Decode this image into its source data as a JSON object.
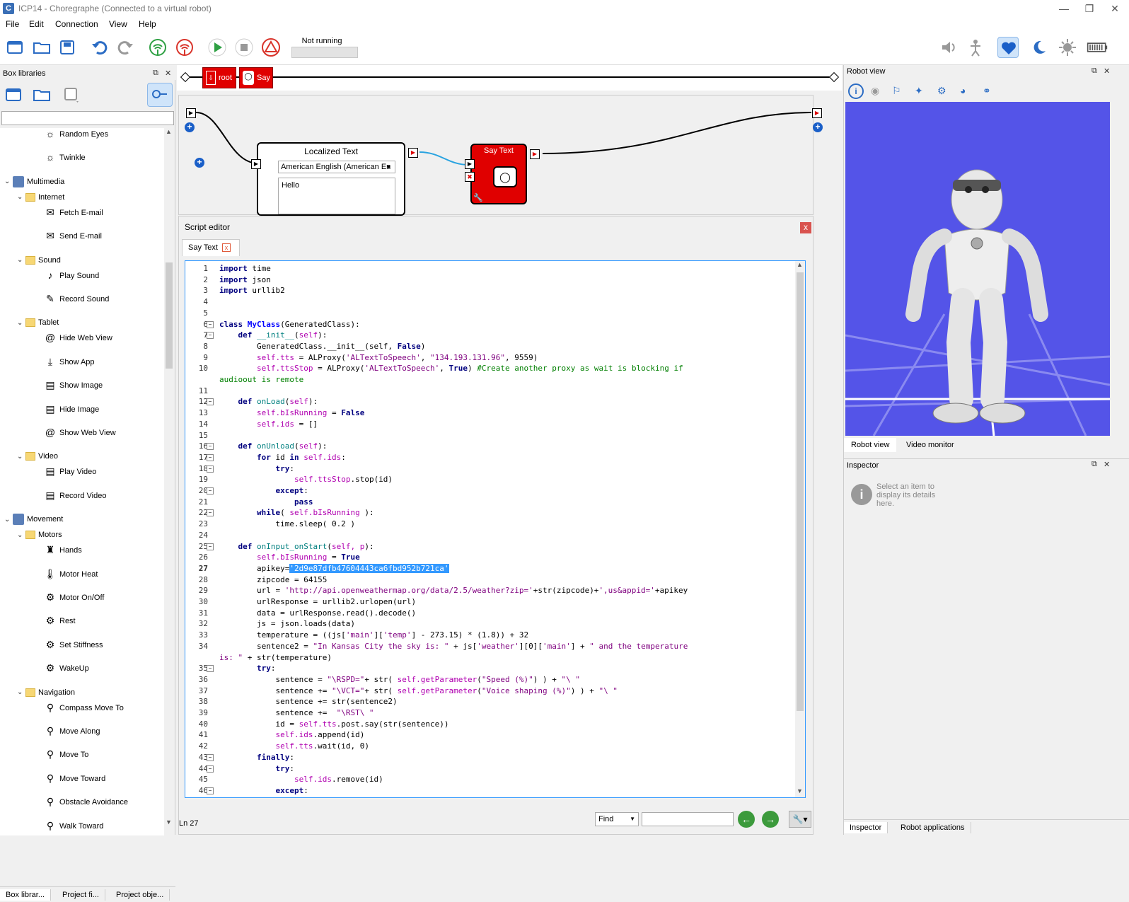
{
  "window": {
    "title": "ICP14 - Choregraphe (Connected to a virtual robot)",
    "app_icon_letter": "C"
  },
  "menu": [
    "File",
    "Edit",
    "Connection",
    "View",
    "Help"
  ],
  "toolbar": {
    "status_label": "Not running"
  },
  "box_libraries": {
    "title": "Box libraries",
    "tree": [
      {
        "label": "Random Eyes",
        "level": 2,
        "type": "box",
        "icon": "random-eyes-icon"
      },
      {
        "label": "Twinkle",
        "level": 2,
        "type": "box",
        "icon": "twinkle-icon"
      },
      {
        "label": "Multimedia",
        "level": 0,
        "type": "category",
        "icon": "multimedia-icon"
      },
      {
        "label": "Internet",
        "level": 1,
        "type": "folder",
        "icon": "folder-icon"
      },
      {
        "label": "Fetch E-mail",
        "level": 2,
        "type": "box",
        "icon": "email-icon"
      },
      {
        "label": "Send E-mail",
        "level": 2,
        "type": "box",
        "icon": "email-icon"
      },
      {
        "label": "Sound",
        "level": 1,
        "type": "folder",
        "icon": "folder-icon"
      },
      {
        "label": "Play Sound",
        "level": 2,
        "type": "box",
        "icon": "music-note-icon"
      },
      {
        "label": "Record Sound",
        "level": 2,
        "type": "box",
        "icon": "pen-icon"
      },
      {
        "label": "Tablet",
        "level": 1,
        "type": "folder",
        "icon": "folder-icon"
      },
      {
        "label": "Hide Web View",
        "level": 2,
        "type": "box",
        "icon": "at-icon"
      },
      {
        "label": "Show App",
        "level": 2,
        "type": "box",
        "icon": "download-icon"
      },
      {
        "label": "Show Image",
        "level": 2,
        "type": "box",
        "icon": "film-icon"
      },
      {
        "label": "Hide Image",
        "level": 2,
        "type": "box",
        "icon": "film-icon"
      },
      {
        "label": "Show Web View",
        "level": 2,
        "type": "box",
        "icon": "at-icon"
      },
      {
        "label": "Video",
        "level": 1,
        "type": "folder",
        "icon": "folder-icon"
      },
      {
        "label": "Play Video",
        "level": 2,
        "type": "box",
        "icon": "film-icon"
      },
      {
        "label": "Record Video",
        "level": 2,
        "type": "box",
        "icon": "film-icon"
      },
      {
        "label": "Movement",
        "level": 0,
        "type": "category",
        "icon": "movement-icon"
      },
      {
        "label": "Motors",
        "level": 1,
        "type": "folder",
        "icon": "folder-icon"
      },
      {
        "label": "Hands",
        "level": 2,
        "type": "box",
        "icon": "robot-icon"
      },
      {
        "label": "Motor Heat",
        "level": 2,
        "type": "box",
        "icon": "thermometer-icon"
      },
      {
        "label": "Motor On/Off",
        "level": 2,
        "type": "box",
        "icon": "gear-icon"
      },
      {
        "label": "Rest",
        "level": 2,
        "type": "box",
        "icon": "gear-icon"
      },
      {
        "label": "Set Stiffness",
        "level": 2,
        "type": "box",
        "icon": "gear-icon"
      },
      {
        "label": "WakeUp",
        "level": 2,
        "type": "box",
        "icon": "gear-icon"
      },
      {
        "label": "Navigation",
        "level": 1,
        "type": "folder",
        "icon": "folder-icon"
      },
      {
        "label": "Compass Move To",
        "level": 2,
        "type": "box",
        "icon": "walk-icon"
      },
      {
        "label": "Move Along",
        "level": 2,
        "type": "box",
        "icon": "walk-icon"
      },
      {
        "label": "Move To",
        "level": 2,
        "type": "box",
        "icon": "walk-icon"
      },
      {
        "label": "Move Toward",
        "level": 2,
        "type": "box",
        "icon": "walk-icon"
      },
      {
        "label": "Obstacle Avoidance",
        "level": 2,
        "type": "box",
        "icon": "walk-icon"
      },
      {
        "label": "Walk Toward",
        "level": 2,
        "type": "box",
        "icon": "walk-icon"
      }
    ],
    "bottom_tabs": [
      "Box librar...",
      "Project fi...",
      "Project obje..."
    ]
  },
  "timeline": {
    "boxes": [
      "root",
      "Say"
    ]
  },
  "flow": {
    "localized_text": {
      "title": "Localized Text",
      "language": "American English (American En",
      "text": "Hello"
    },
    "say_text": {
      "title": "Say Text"
    }
  },
  "script_editor": {
    "title": "Script editor",
    "tab": "Say Text",
    "close_symbol": "x",
    "line_indicator": "Ln 27",
    "find_label": "Find",
    "lines": [
      {
        "n": "1",
        "html": "<span class='kw'>import</span> time",
        "fold": false
      },
      {
        "n": "2",
        "html": "<span class='kw'>import</span> json",
        "fold": false
      },
      {
        "n": "3",
        "html": "<span class='kw'>import</span> urllib2",
        "fold": false
      },
      {
        "n": "4",
        "html": "",
        "fold": false
      },
      {
        "n": "5",
        "html": "",
        "fold": false
      },
      {
        "n": "6",
        "html": "<span class='kw'>class</span> <span class='cls'>MyClass</span>(GeneratedClass):",
        "fold": true
      },
      {
        "n": "7",
        "html": "    <span class='kw'>def</span> <span class='fn'>__init__</span>(<span class='self'>self</span>):",
        "fold": true
      },
      {
        "n": "8",
        "html": "        GeneratedClass.__init__(self, <span class='kw'>False</span>)",
        "fold": false
      },
      {
        "n": "9",
        "html": "        <span class='self'>self.tts</span> = ALProxy(<span class='st'>'ALTextToSpeech'</span>, <span class='st'>\"134.193.131.96\"</span>, 9559)",
        "fold": false
      },
      {
        "n": "10",
        "html": "        <span class='self'>self.ttsStop</span> = ALProxy(<span class='st'>'ALTextToSpeech'</span>, <span class='kw'>True</span>) <span class='cm'>#Create another proxy as wait is blocking if</span>",
        "fold": false
      },
      {
        "n": "",
        "html": "<span class='cm'>audioout is remote</span>",
        "fold": false
      },
      {
        "n": "11",
        "html": "",
        "fold": false
      },
      {
        "n": "12",
        "html": "    <span class='kw'>def</span> <span class='fn'>onLoad</span>(<span class='self'>self</span>):",
        "fold": true
      },
      {
        "n": "13",
        "html": "        <span class='self'>self.bIsRunning</span> = <span class='kw'>False</span>",
        "fold": false
      },
      {
        "n": "14",
        "html": "        <span class='self'>self.ids</span> = []",
        "fold": false
      },
      {
        "n": "15",
        "html": "",
        "fold": false
      },
      {
        "n": "16",
        "html": "    <span class='kw'>def</span> <span class='fn'>onUnload</span>(<span class='self'>self</span>):",
        "fold": true
      },
      {
        "n": "17",
        "html": "        <span class='kw'>for</span> id <span class='kw'>in</span> <span class='self'>self.ids</span>:",
        "fold": true
      },
      {
        "n": "18",
        "html": "            <span class='kw'>try</span>:",
        "fold": true
      },
      {
        "n": "19",
        "html": "                <span class='self'>self.ttsStop</span>.stop(id)",
        "fold": false
      },
      {
        "n": "20",
        "html": "            <span class='kw'>except</span>:",
        "fold": true
      },
      {
        "n": "21",
        "html": "                <span class='kw'>pass</span>",
        "fold": false
      },
      {
        "n": "22",
        "html": "        <span class='kw'>while</span>( <span class='self'>self.bIsRunning</span> ):",
        "fold": true
      },
      {
        "n": "23",
        "html": "            time.sleep( 0.2 )",
        "fold": false
      },
      {
        "n": "24",
        "html": "",
        "fold": false
      },
      {
        "n": "25",
        "html": "    <span class='kw'>def</span> <span class='fn'>onInput_onStart</span>(<span class='self'>self, p</span>):",
        "fold": true
      },
      {
        "n": "26",
        "html": "        <span class='self'>self.bIsRunning</span> = <span class='kw'>True</span>",
        "fold": false
      },
      {
        "n": "27",
        "html": "        apikey=<span class='hl'>'2d9e87dfb47604443ca6fbd952b721ca'</span>",
        "fold": false
      },
      {
        "n": "28",
        "html": "        zipcode = 64155",
        "fold": false
      },
      {
        "n": "29",
        "html": "        url = <span class='st'>'http://api.openweathermap.org/data/2.5/weather?zip='</span>+str(zipcode)+<span class='st'>',us&amp;appid='</span>+apikey",
        "fold": false
      },
      {
        "n": "30",
        "html": "        urlResponse = urllib2.urlopen(url)",
        "fold": false
      },
      {
        "n": "31",
        "html": "        data = urlResponse.read().decode()",
        "fold": false
      },
      {
        "n": "32",
        "html": "        js = json.loads(data)",
        "fold": false
      },
      {
        "n": "33",
        "html": "        temperature = ((js[<span class='st'>'main'</span>][<span class='st'>'temp'</span>] - 273.15) * (1.8)) + 32",
        "fold": false
      },
      {
        "n": "34",
        "html": "        sentence2 = <span class='st'>\"In Kansas City the sky is: \"</span> + js[<span class='st'>'weather'</span>][0][<span class='st'>'main'</span>] + <span class='st'>\" and the temperature</span>",
        "fold": false
      },
      {
        "n": "",
        "html": "<span class='st'>is: \"</span> + str(temperature)",
        "fold": false
      },
      {
        "n": "35",
        "html": "        <span class='kw'>try</span>:",
        "fold": true
      },
      {
        "n": "36",
        "html": "            sentence = <span class='st'>\"\\RSPD=\"</span>+ str( <span class='self'>self.getParameter</span>(<span class='st'>\"Speed (%)\"</span>) ) + <span class='st'>\"\\ \"</span>",
        "fold": false
      },
      {
        "n": "37",
        "html": "            sentence += <span class='st'>\"\\VCT=\"</span>+ str( <span class='self'>self.getParameter</span>(<span class='st'>\"Voice shaping (%)\"</span>) ) + <span class='st'>\"\\ \"</span>",
        "fold": false
      },
      {
        "n": "38",
        "html": "            sentence += str(sentence2)",
        "fold": false
      },
      {
        "n": "39",
        "html": "            sentence +=  <span class='st'>\"\\RST\\ \"</span>",
        "fold": false
      },
      {
        "n": "40",
        "html": "            id = <span class='self'>self.tts</span>.post.say(str(sentence))",
        "fold": false
      },
      {
        "n": "41",
        "html": "            <span class='self'>self.ids</span>.append(id)",
        "fold": false
      },
      {
        "n": "42",
        "html": "            <span class='self'>self.tts</span>.wait(id, 0)",
        "fold": false
      },
      {
        "n": "43",
        "html": "        <span class='kw'>finally</span>:",
        "fold": true
      },
      {
        "n": "44",
        "html": "            <span class='kw'>try</span>:",
        "fold": true
      },
      {
        "n": "45",
        "html": "                <span class='self'>self.ids</span>.remove(id)",
        "fold": false
      },
      {
        "n": "46",
        "html": "            <span class='kw'>except</span>:",
        "fold": true
      }
    ]
  },
  "robot_view": {
    "title": "Robot view",
    "tabs": [
      "Robot view",
      "Video monitor"
    ],
    "background": "#5454e8"
  },
  "inspector": {
    "title": "Inspector",
    "message": "Select an item to display its details here.",
    "info_glyph": "i",
    "tabs": [
      "Inspector",
      "Robot applications"
    ]
  },
  "colors": {
    "box_red": "#e00000",
    "selection": "#3399ff",
    "link_blue": "#29a3e0"
  }
}
